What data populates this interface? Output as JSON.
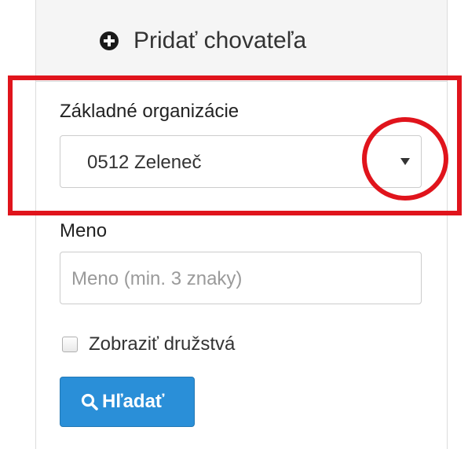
{
  "header": {
    "icon": "plus-circle-icon",
    "title": "Pridať chovateľa"
  },
  "organization": {
    "label": "Základné organizácie",
    "selected": "0512 Zeleneč",
    "caret_icon": "caret-down-icon"
  },
  "name": {
    "label": "Meno",
    "value": "",
    "placeholder": "Meno (min. 3 znaky)"
  },
  "show_cooperatives": {
    "label": "Zobraziť družstvá",
    "checked": false
  },
  "search_button": {
    "icon": "search-icon",
    "label": "Hľadať",
    "color": "#2a8fd8"
  },
  "annotations": {
    "color": "#e0141c"
  }
}
